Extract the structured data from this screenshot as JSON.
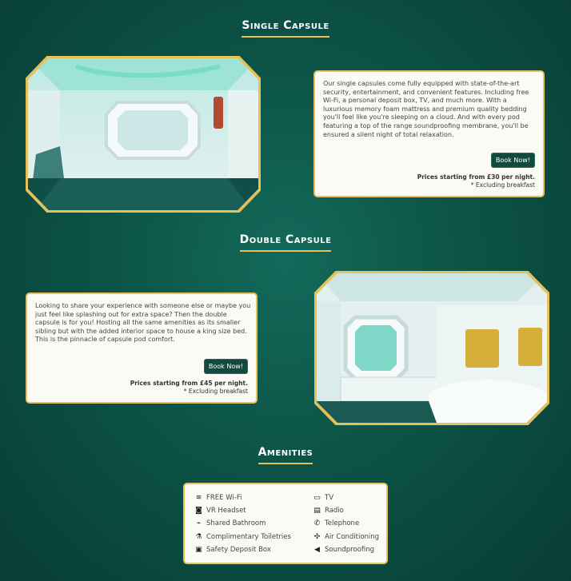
{
  "single": {
    "title": "Single Capsule",
    "description": "Our single capsules come fully equipped with state-of-the-art security, entertainment, and convenient features. Including free Wi-Fi, a personal deposit box, TV, and much more. With a luxurious memory foam mattress and premium quality bedding you'll feel like you're sleeping on a cloud. And with every pod featuring a top of the range soundproofing membrane, you'll be ensured a silent night of total relaxation.",
    "button": "Book Now!",
    "price": "Prices starting from £30 per night.",
    "note": "* Excluding breakfast"
  },
  "double": {
    "title": "Double Capsule",
    "description": "Looking to share your experience with someone else or maybe you just feel like splashing out for extra space? Then the double capsule is for you! Hosting all the same amenities as its smaller sibling but with the added interior space to house a king size bed. This is the pinnacle of capsule pod comfort.",
    "button": "Book Now!",
    "price": "Prices starting from £45 per night.",
    "note": "* Excluding breakfast"
  },
  "amenities": {
    "title": "Amenities",
    "left": [
      {
        "label": "FREE Wi-Fi",
        "icon": "wifi-icon"
      },
      {
        "label": "VR Headset",
        "icon": "vr-headset-icon"
      },
      {
        "label": "Shared Bathroom",
        "icon": "shower-icon"
      },
      {
        "label": "Complimentary Toiletries",
        "icon": "toiletries-icon"
      },
      {
        "label": "Safety Deposit Box",
        "icon": "safe-icon"
      }
    ],
    "right": [
      {
        "label": "TV",
        "icon": "tv-icon"
      },
      {
        "label": "Radio",
        "icon": "radio-icon"
      },
      {
        "label": "Telephone",
        "icon": "telephone-icon"
      },
      {
        "label": "Air Conditioning",
        "icon": "fan-icon"
      },
      {
        "label": "Soundproofing",
        "icon": "speaker-mute-icon"
      }
    ]
  },
  "colors": {
    "accent": "#e6c15a",
    "background": "#0c5346",
    "button": "#124a40"
  }
}
